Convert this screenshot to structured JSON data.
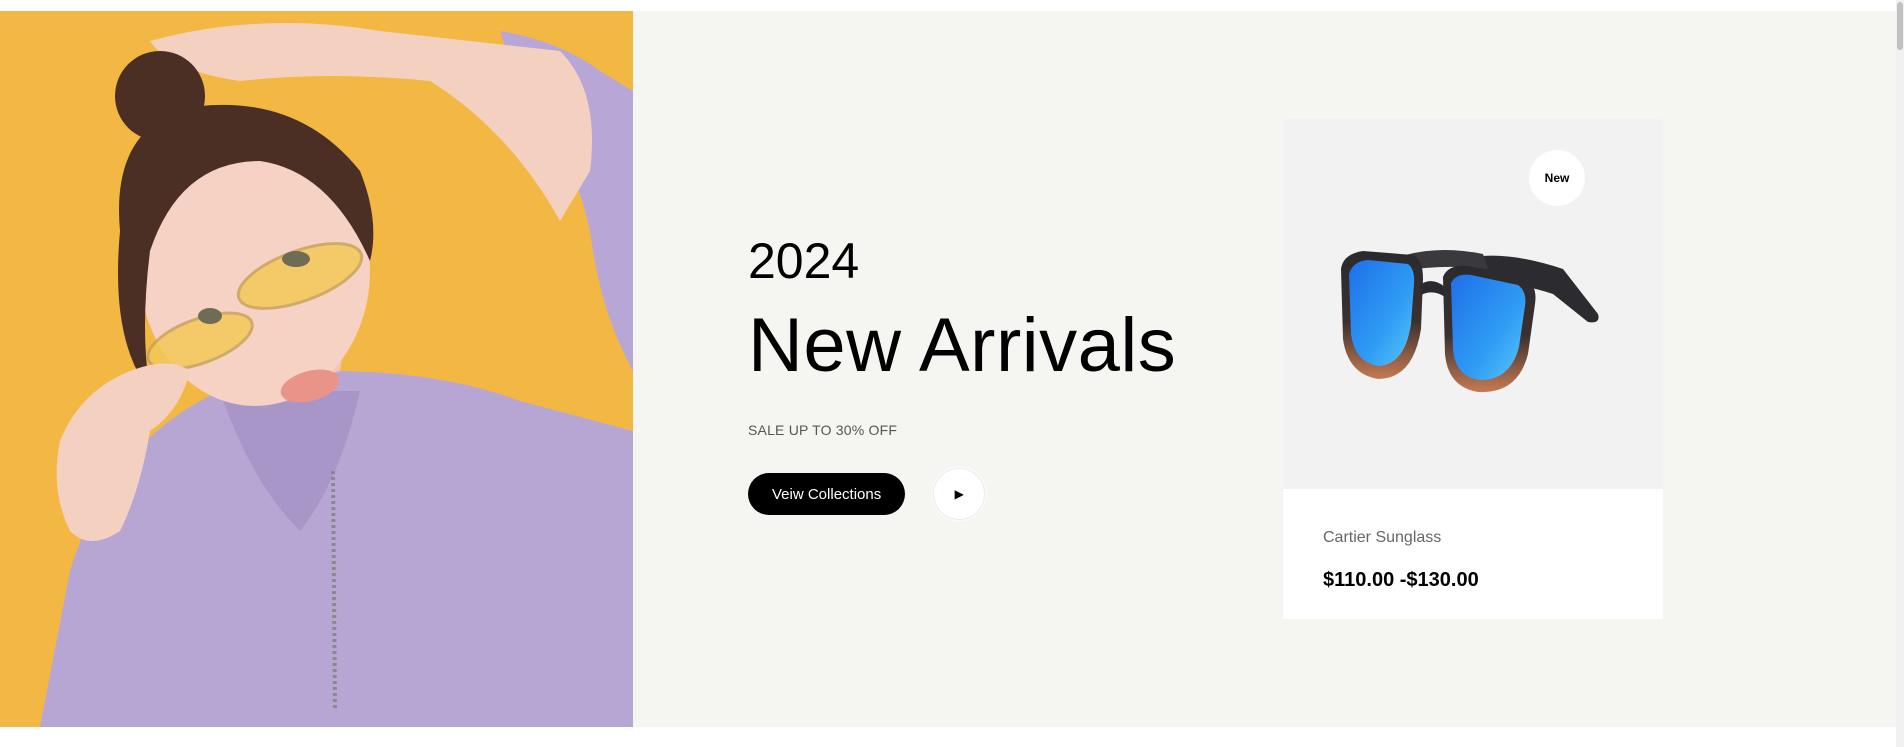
{
  "hero": {
    "year": "2024",
    "title": "New Arrivals",
    "subtitle": "SALE UP TO 30% OFF",
    "cta_label": "Veiw Collections",
    "play_icon": "play-icon",
    "photo_alt": "Model with yellow sunglasses",
    "photo_bg": "#f2b843",
    "bg": "#f5f5f1"
  },
  "product": {
    "badge": "New",
    "name": "Cartier Sunglass",
    "price": "$110.00 -$130.00",
    "image_alt": "Sunglasses with blue lenses"
  }
}
